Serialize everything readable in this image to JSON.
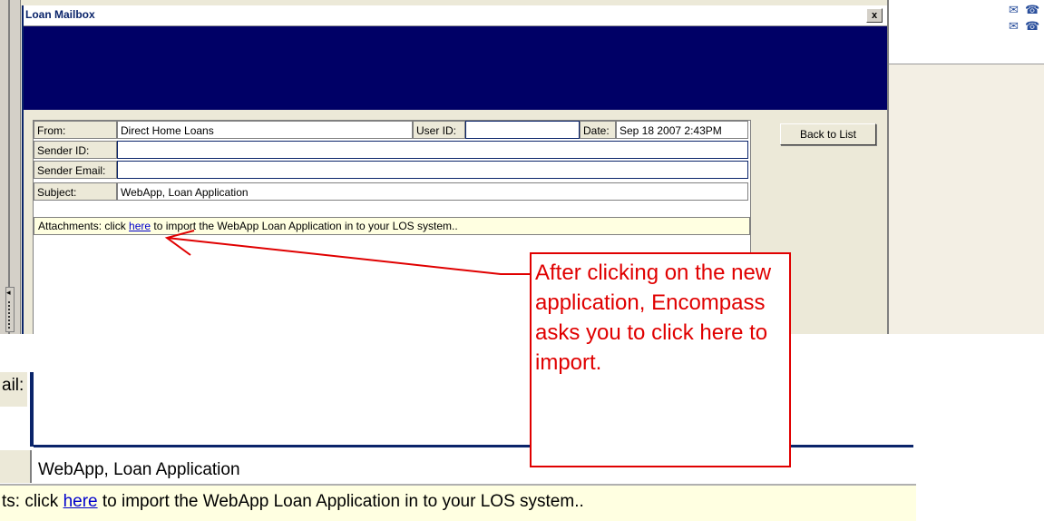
{
  "dialog": {
    "title": "Loan Mailbox",
    "close_glyph": "x"
  },
  "form": {
    "from_label": "From:",
    "from_value": "Direct Home Loans",
    "user_id_label": "User ID:",
    "user_id_value": "",
    "date_label": "Date:",
    "date_value": "Sep 18 2007 2:43PM",
    "sender_id_label": "Sender ID:",
    "sender_id_value": "",
    "sender_email_label": "Sender Email:",
    "sender_email_value": "",
    "subject_label": "Subject:",
    "subject_value": "WebApp, Loan Application",
    "attachments_prefix": "Attachments: click ",
    "attachments_link": "here",
    "attachments_suffix": " to import the WebApp Loan Application in to your LOS system.."
  },
  "back_button_label": "Back to List",
  "zoom": {
    "email_label_fragment": "ail:",
    "subject_value": "WebApp, Loan Application",
    "attachments_prefix": "ts: click ",
    "attachments_link": "here",
    "attachments_suffix": " to import the WebApp Loan Application in to your LOS system.."
  },
  "callout": {
    "text": "After clicking on the new application, Encompass asks you to click here to import.",
    "color": "#e00000"
  },
  "icons": [
    "mail-icon",
    "phone-icon"
  ],
  "colors": {
    "banner": "#000066",
    "attachment_row": "#ffffe1",
    "link": "#0000cc"
  }
}
